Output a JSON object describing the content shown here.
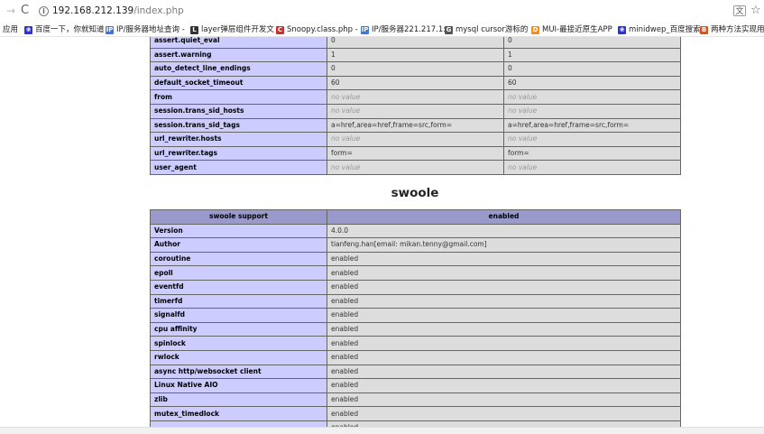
{
  "browser": {
    "url_host": "192.168.212.139",
    "url_path": "/index.php",
    "bookmarks": [
      {
        "label": "应用",
        "icon": "apps-grid-icon",
        "color": "#4285f4",
        "glyph": ""
      },
      {
        "label": "百度一下，你就知道",
        "icon": "baidu-paw-icon",
        "color": "#2932e1",
        "glyph": "❀"
      },
      {
        "label": "IP/服务器地址查询 -",
        "icon": "site-favicon-icon",
        "color": "#3c78d8",
        "glyph": "IP"
      },
      {
        "label": "layer弹层组件开发文",
        "icon": "layer-favicon-icon",
        "color": "#333333",
        "glyph": "L"
      },
      {
        "label": "Snoopy.class.php -",
        "icon": "csdn-favicon-icon",
        "color": "#c9302c",
        "glyph": "C"
      },
      {
        "label": "IP/服务器221.217.1:",
        "icon": "site-favicon-icon",
        "color": "#3c78d8",
        "glyph": "IP"
      },
      {
        "label": "mysql cursor游标的",
        "icon": "google-g-icon",
        "color": "#555555",
        "glyph": "G"
      },
      {
        "label": "MUI-最接近原生APP",
        "icon": "mui-favicon-icon",
        "color": "#ff8c00",
        "glyph": "D"
      },
      {
        "label": "minidwep_百度搜索",
        "icon": "baidu-paw-icon",
        "color": "#2932e1",
        "glyph": "❀"
      },
      {
        "label": "两种方法实现用",
        "icon": "cnblogs-favicon-icon",
        "color": "#e0501b",
        "glyph": "B"
      }
    ]
  },
  "directives_table": {
    "rows": [
      {
        "name": "assert.quiet_eval",
        "local": "0",
        "master": "0",
        "no_value": false
      },
      {
        "name": "assert.warning",
        "local": "1",
        "master": "1",
        "no_value": false
      },
      {
        "name": "auto_detect_line_endings",
        "local": "0",
        "master": "0",
        "no_value": false
      },
      {
        "name": "default_socket_timeout",
        "local": "60",
        "master": "60",
        "no_value": false
      },
      {
        "name": "from",
        "local": "no value",
        "master": "no value",
        "no_value": true
      },
      {
        "name": "session.trans_sid_hosts",
        "local": "no value",
        "master": "no value",
        "no_value": true
      },
      {
        "name": "session.trans_sid_tags",
        "local": "a=href,area=href,frame=src,form=",
        "master": "a=href,area=href,frame=src,form=",
        "no_value": false
      },
      {
        "name": "url_rewriter.hosts",
        "local": "no value",
        "master": "no value",
        "no_value": true
      },
      {
        "name": "url_rewriter.tags",
        "local": "form=",
        "master": "form=",
        "no_value": false
      },
      {
        "name": "user_agent",
        "local": "no value",
        "master": "no value",
        "no_value": true
      }
    ]
  },
  "swoole": {
    "title": "swoole",
    "header": [
      "swoole support",
      "enabled"
    ],
    "rows": [
      {
        "name": "Version",
        "value": "4.0.0"
      },
      {
        "name": "Author",
        "value": "tianfeng.han[email: mikan.tenny@gmail.com]"
      },
      {
        "name": "coroutine",
        "value": "enabled"
      },
      {
        "name": "epoll",
        "value": "enabled"
      },
      {
        "name": "eventfd",
        "value": "enabled"
      },
      {
        "name": "timerfd",
        "value": "enabled"
      },
      {
        "name": "signalfd",
        "value": "enabled"
      },
      {
        "name": "cpu affinity",
        "value": "enabled"
      },
      {
        "name": "spinlock",
        "value": "enabled"
      },
      {
        "name": "rwlock",
        "value": "enabled"
      },
      {
        "name": "async http/websocket client",
        "value": "enabled"
      },
      {
        "name": "Linux Native AIO",
        "value": "enabled"
      },
      {
        "name": "zlib",
        "value": "enabled"
      },
      {
        "name": "mutex_timedlock",
        "value": "enabled"
      },
      {
        "name": "",
        "value": "enabled"
      }
    ]
  }
}
